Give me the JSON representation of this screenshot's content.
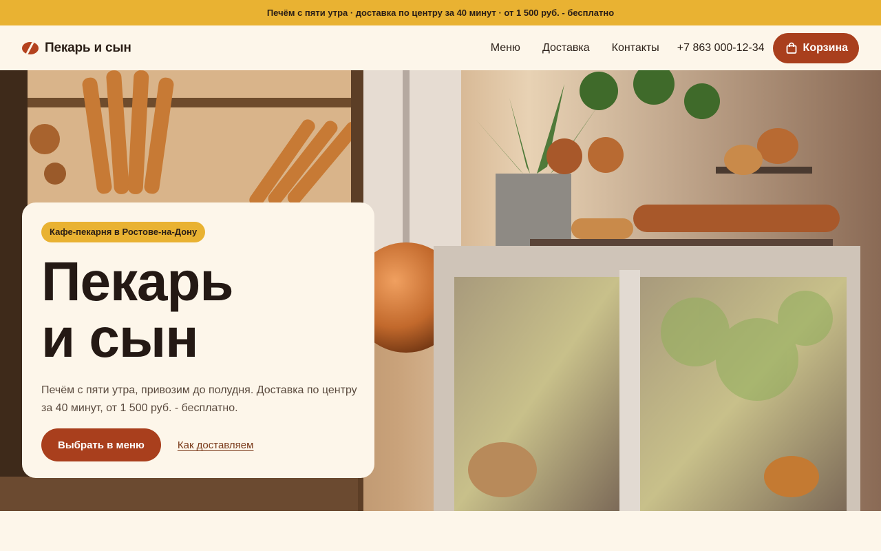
{
  "promo": {
    "text": "Печём с пяти утра · доставка по центру за 40 минут · от 1 500 руб. - бесплатно"
  },
  "header": {
    "logo_text": "Пекарь и сын",
    "nav": [
      "Меню",
      "Доставка",
      "Контакты"
    ],
    "phone": "+7 863 000-12-34",
    "cart_label": "Корзина"
  },
  "hero": {
    "badge": "Кафе-пекарня в Ростове-на-Дону",
    "title": "Пекарь\nи сын",
    "description": "Печём с пяти утра, привозим до полудня. Доставка по центру за 40 минут, от 1 500 руб. - бесплатно.",
    "primary_cta": "Выбрать в меню",
    "secondary_link": "Как доставляем"
  },
  "colors": {
    "accent": "#a93f1d",
    "promo_bg": "#e9b232",
    "page_bg": "#fdf6ea",
    "text": "#2a1e16"
  },
  "icons": {
    "logo": "bread-slice-icon",
    "cart": "shopping-bag-icon"
  }
}
